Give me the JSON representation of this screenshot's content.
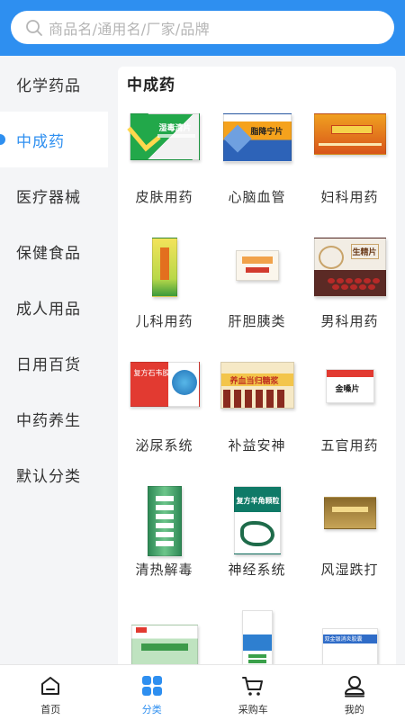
{
  "search": {
    "placeholder": "商品名/通用名/厂家/品牌"
  },
  "sidebar": {
    "items": [
      {
        "label": "化学药品"
      },
      {
        "label": "中成药"
      },
      {
        "label": "医疗器械"
      },
      {
        "label": "保健食品"
      },
      {
        "label": "成人用品"
      },
      {
        "label": "日用百货"
      },
      {
        "label": "中药养生"
      },
      {
        "label": "默认分类"
      }
    ]
  },
  "content": {
    "title": "中成药",
    "categories": [
      {
        "label": "皮肤用药",
        "image_text": "湿毒清片"
      },
      {
        "label": "心脑血管",
        "image_text": "脂降宁片"
      },
      {
        "label": "妇科用药",
        "image_text": ""
      },
      {
        "label": "儿科用药",
        "image_text": ""
      },
      {
        "label": "肝胆胰类",
        "image_text": ""
      },
      {
        "label": "男科用药",
        "image_text": "生精片"
      },
      {
        "label": "泌尿系统",
        "image_text": "复方石韦胶囊"
      },
      {
        "label": "补益安神",
        "image_text": "养血当归糖浆"
      },
      {
        "label": "五官用药",
        "image_text": "金嗓片"
      },
      {
        "label": "清热解毒",
        "image_text": ""
      },
      {
        "label": "神经系统",
        "image_text": "复方羊角颗粒"
      },
      {
        "label": "风湿跌打",
        "image_text": ""
      },
      {
        "label": "",
        "image_text": ""
      },
      {
        "label": "",
        "image_text": ""
      },
      {
        "label": "",
        "image_text": "双金银消炎胶囊"
      }
    ]
  },
  "tabbar": {
    "items": [
      {
        "label": "首页"
      },
      {
        "label": "分类"
      },
      {
        "label": "采购车"
      },
      {
        "label": "我的"
      }
    ]
  },
  "colors": {
    "accent": "#2e8ff0",
    "background": "#f4f5f7"
  }
}
